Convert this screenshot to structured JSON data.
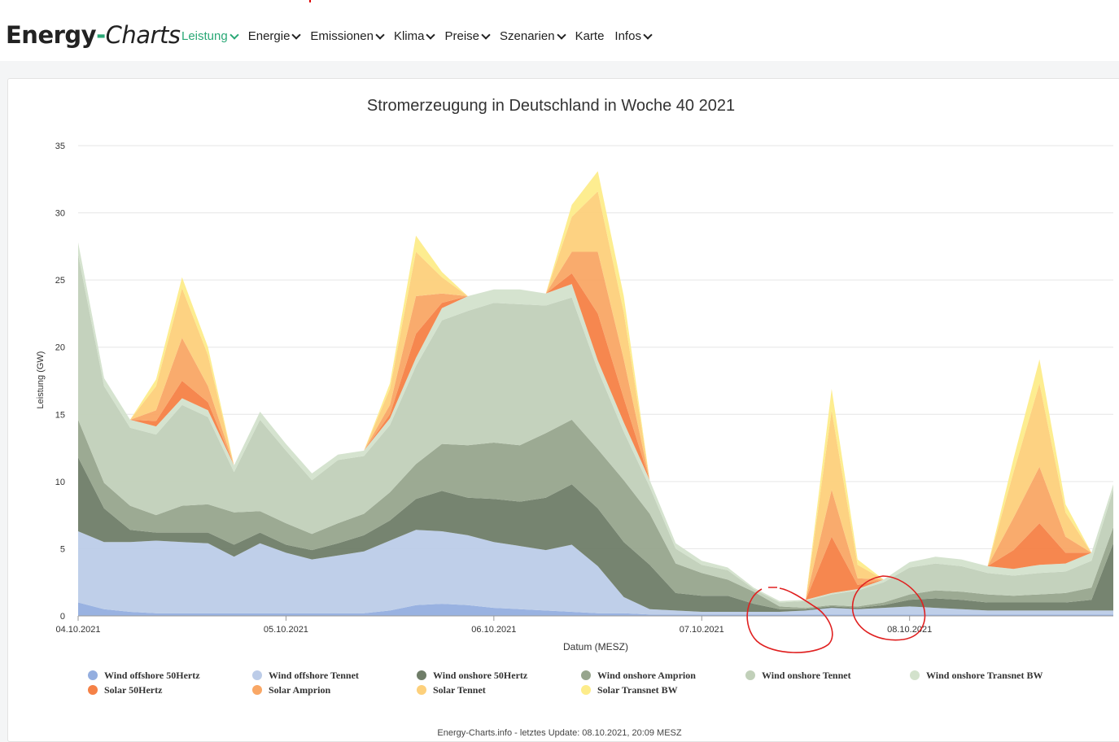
{
  "header": {
    "logo_part1": "Energy",
    "logo_dash": "-",
    "logo_part2": "Charts",
    "nav": [
      {
        "label": "Leistung",
        "active": true,
        "dropdown": true
      },
      {
        "label": "Energie",
        "active": false,
        "dropdown": true
      },
      {
        "label": "Emissionen",
        "active": false,
        "dropdown": true
      },
      {
        "label": "Klima",
        "active": false,
        "dropdown": true
      },
      {
        "label": "Preise",
        "active": false,
        "dropdown": true
      },
      {
        "label": "Szenarien",
        "active": false,
        "dropdown": true
      },
      {
        "label": "Karte",
        "active": false,
        "dropdown": false
      },
      {
        "label": "Infos",
        "active": false,
        "dropdown": true
      }
    ]
  },
  "footer": {
    "text": "Energy-Charts.info - letztes Update: 08.10.2021, 20:09 MESZ"
  },
  "colors": {
    "accent": "#2aa876",
    "annotation": "#e02020"
  },
  "chart_data": {
    "type": "area",
    "stacked": true,
    "title": "Stromerzeugung in Deutschland in Woche 40 2021",
    "xlabel": "Datum (MESZ)",
    "ylabel": "Leistung (GW)",
    "ylim": [
      0,
      35
    ],
    "yticks": [
      0,
      5,
      10,
      15,
      20,
      25,
      30,
      35
    ],
    "xlim": [
      0,
      4.98
    ],
    "xticks": [
      {
        "pos": 0,
        "label": "04.10.2021"
      },
      {
        "pos": 1,
        "label": "05.10.2021"
      },
      {
        "pos": 2,
        "label": "06.10.2021"
      },
      {
        "pos": 3,
        "label": "07.10.2021"
      },
      {
        "pos": 4,
        "label": "08.10.2021"
      }
    ],
    "x_unit": "days since 04.10.2021 00:00",
    "grid": "horizontal",
    "legend_position": "bottom",
    "annotations": "two hand-drawn red circles around 07.10.2021 morning and evening lows",
    "x": [
      0,
      0.125,
      0.25,
      0.375,
      0.5,
      0.625,
      0.75,
      0.875,
      1,
      1.125,
      1.25,
      1.375,
      1.5,
      1.625,
      1.75,
      1.875,
      2,
      2.125,
      2.25,
      2.375,
      2.5,
      2.625,
      2.75,
      2.875,
      3,
      3.125,
      3.25,
      3.375,
      3.5,
      3.625,
      3.75,
      3.875,
      4,
      4.125,
      4.25,
      4.375,
      4.5,
      4.625,
      4.75,
      4.875,
      4.98
    ],
    "series": [
      {
        "name": "Wind offshore 50Hertz",
        "color": "#94aedf",
        "values": [
          1.0,
          0.5,
          0.3,
          0.2,
          0.2,
          0.2,
          0.2,
          0.2,
          0.2,
          0.2,
          0.2,
          0.2,
          0.4,
          0.8,
          0.9,
          0.8,
          0.6,
          0.5,
          0.4,
          0.3,
          0.2,
          0.2,
          0.1,
          0.1,
          0.1,
          0.1,
          0.1,
          0.1,
          0.1,
          0.1,
          0.1,
          0.1,
          0.1,
          0.1,
          0.1,
          0.1,
          0.1,
          0.1,
          0.1,
          0.1,
          0.1
        ]
      },
      {
        "name": "Wind offshore Tennet",
        "color": "#bccce8",
        "values": [
          5.3,
          5.0,
          5.2,
          5.4,
          5.3,
          5.2,
          4.2,
          5.2,
          4.5,
          4.0,
          4.3,
          4.6,
          5.2,
          5.6,
          5.4,
          5.2,
          4.9,
          4.7,
          4.5,
          5.0,
          3.5,
          1.2,
          0.4,
          0.3,
          0.2,
          0.2,
          0.2,
          0.2,
          0.3,
          0.5,
          0.4,
          0.5,
          0.6,
          0.5,
          0.4,
          0.3,
          0.3,
          0.3,
          0.3,
          0.3,
          0.3
        ]
      },
      {
        "name": "Wind onshore 50Hertz",
        "color": "#6f7d68",
        "values": [
          5.5,
          2.5,
          0.9,
          0.6,
          0.7,
          0.8,
          0.9,
          0.8,
          0.6,
          0.7,
          0.9,
          1.2,
          1.5,
          2.3,
          3.0,
          2.8,
          3.2,
          3.3,
          3.9,
          4.5,
          4.3,
          4.1,
          3.3,
          1.3,
          1.2,
          1.2,
          0.6,
          0.2,
          0.1,
          0.1,
          0.1,
          0.2,
          0.5,
          0.7,
          0.7,
          0.6,
          0.6,
          0.6,
          0.6,
          0.8,
          5.0
        ]
      },
      {
        "name": "Wind onshore Amprion",
        "color": "#97a58d",
        "values": [
          2.8,
          1.9,
          1.8,
          1.3,
          2.0,
          2.1,
          2.4,
          1.6,
          1.6,
          1.2,
          1.5,
          1.6,
          2.1,
          2.6,
          3.5,
          3.9,
          4.2,
          4.2,
          4.8,
          4.8,
          4.4,
          4.6,
          3.8,
          2.2,
          1.7,
          1.2,
          0.9,
          0.2,
          0.1,
          0.1,
          0.1,
          0.2,
          0.4,
          0.6,
          0.6,
          0.6,
          0.5,
          0.6,
          0.7,
          0.9,
          1.2
        ]
      },
      {
        "name": "Wind onshore Tennet",
        "color": "#c1d0b9",
        "values": [
          12.3,
          7.2,
          5.8,
          6.0,
          7.5,
          6.5,
          3.0,
          6.8,
          5.4,
          4.0,
          4.7,
          4.3,
          5.0,
          7.3,
          9.2,
          10.0,
          10.4,
          10.5,
          9.5,
          9.1,
          5.9,
          3.6,
          2.0,
          1.1,
          0.6,
          0.7,
          0.2,
          0.3,
          0.5,
          0.8,
          1.2,
          1.5,
          2.0,
          2.0,
          1.9,
          1.6,
          1.5,
          1.6,
          1.6,
          2.0,
          2.8
        ]
      },
      {
        "name": "Wind onshore Transnet BW",
        "color": "#d3e2cc",
        "values": [
          0.9,
          0.6,
          0.6,
          0.6,
          0.5,
          0.5,
          0.5,
          0.6,
          0.5,
          0.5,
          0.4,
          0.4,
          0.5,
          0.6,
          0.9,
          1.1,
          1.0,
          1.1,
          0.9,
          1.0,
          0.7,
          0.7,
          0.5,
          0.4,
          0.3,
          0.2,
          0.1,
          0.1,
          0.1,
          0.1,
          0.1,
          0.2,
          0.4,
          0.5,
          0.5,
          0.5,
          0.5,
          0.6,
          0.6,
          0.6,
          0.4
        ]
      },
      {
        "name": "Solar 50Hertz",
        "color": "#f58146",
        "values": [
          0,
          0,
          0,
          0.4,
          1.3,
          0.6,
          0,
          0,
          0,
          0,
          0,
          0,
          0.3,
          1.8,
          0.4,
          0,
          0,
          0,
          0,
          0.8,
          3.5,
          1.8,
          0,
          0,
          0,
          0,
          0,
          0,
          0,
          4.2,
          0.3,
          0,
          0,
          0,
          0,
          0,
          1.4,
          3.1,
          0.8,
          0,
          0
        ]
      },
      {
        "name": "Solar Amprion",
        "color": "#f9a765",
        "values": [
          0,
          0,
          0,
          0.8,
          3.2,
          1.2,
          0,
          0,
          0,
          0,
          0,
          0,
          0.7,
          2.8,
          0.7,
          0,
          0,
          0,
          0,
          1.6,
          4.6,
          2.9,
          0,
          0,
          0,
          0,
          0,
          0,
          0,
          3.5,
          0.5,
          0,
          0,
          0,
          0,
          0,
          2.4,
          4.2,
          1.2,
          0,
          0
        ]
      },
      {
        "name": "Solar Tennet",
        "color": "#fdd07b",
        "values": [
          0,
          0,
          0,
          1.8,
          3.7,
          2.3,
          0,
          0,
          0,
          0,
          0,
          0,
          1.2,
          3.3,
          1.2,
          0,
          0,
          0,
          0,
          2.6,
          4.5,
          3.5,
          0,
          0,
          0,
          0,
          0,
          0,
          0,
          5.9,
          1.0,
          0,
          0,
          0,
          0,
          0,
          3.4,
          6.2,
          1.8,
          0,
          0
        ]
      },
      {
        "name": "Solar Transnet BW",
        "color": "#fdec8a",
        "values": [
          0,
          0,
          0,
          0.5,
          0.8,
          0.6,
          0,
          0,
          0,
          0,
          0,
          0,
          0.4,
          1.2,
          0.4,
          0,
          0,
          0,
          0,
          0.9,
          1.5,
          1.2,
          0,
          0,
          0,
          0,
          0,
          0,
          0,
          1.6,
          0.4,
          0,
          0,
          0,
          0,
          0,
          1.0,
          1.8,
          0.6,
          0,
          0
        ]
      }
    ]
  }
}
